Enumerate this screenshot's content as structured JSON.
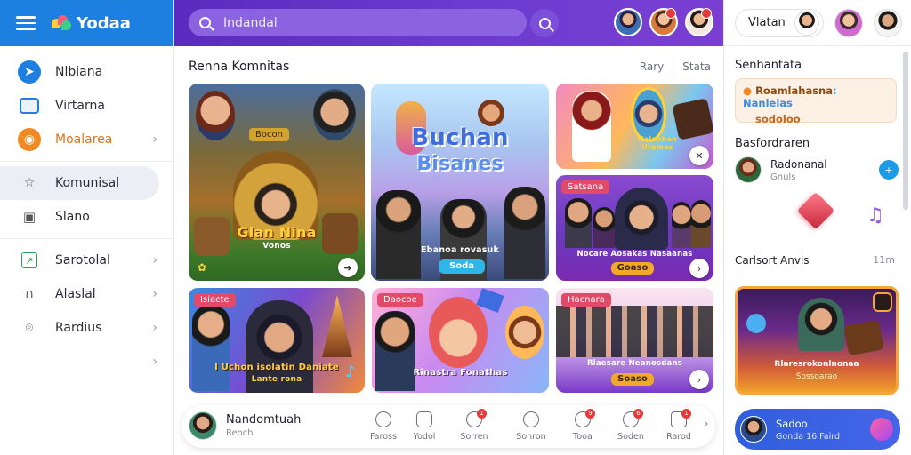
{
  "app": {
    "name": "Yodaa"
  },
  "sidebar": {
    "items": [
      {
        "label": "Nlbiana",
        "icon": "send-icon"
      },
      {
        "label": "Virtarna",
        "icon": "screen-icon"
      },
      {
        "label": "Moalarea",
        "icon": "badge-icon"
      },
      {
        "label": "Komunisal",
        "icon": "star-icon"
      },
      {
        "label": "Slano",
        "icon": "picture-icon"
      },
      {
        "label": "Sarotolal",
        "icon": "chart-icon"
      },
      {
        "label": "Alaslal",
        "icon": "headset-icon"
      },
      {
        "label": "Rardius",
        "icon": "location-icon"
      }
    ]
  },
  "topbar": {
    "search_placeholder": "Indandal"
  },
  "main": {
    "title": "Renna Komnitas",
    "action_1": "Rary",
    "action_2": "Stata",
    "cards": {
      "c1": {
        "chip": "Bocon",
        "caption": "Glan Nina",
        "sub": "Vonos"
      },
      "c2": {
        "heading1": "Buchan",
        "heading2": "Bisanes",
        "caption": "Ebanoa rovasuk",
        "pill": "Soda"
      },
      "c3": {
        "caption": "Haloohan Uramas"
      },
      "c4": {
        "chip": "Satsana",
        "caption": "Nocare Aosakas Nasaanas",
        "pill": "Goaso"
      },
      "c5": {
        "chip": "Isiacte",
        "caption": "I Uchon isolatin Daniate",
        "sub": "Lante rona"
      },
      "c6": {
        "chip": "Daocoe",
        "caption": "Rinastra Fonathas"
      },
      "c7": {
        "chip": "Hacnara",
        "caption": "Rlaesare Neanosdans",
        "pill": "Soaso"
      }
    },
    "dock": {
      "user_name": "Nandomtuah",
      "user_sub": "Reoch",
      "items": [
        {
          "label": "Faross",
          "badge": ""
        },
        {
          "label": "Yodol",
          "badge": ""
        },
        {
          "label": "Sorren",
          "badge": "1"
        },
        {
          "label": "Sonron",
          "badge": ""
        },
        {
          "label": "Tooa",
          "badge": "9"
        },
        {
          "label": "Soden",
          "badge": "6"
        },
        {
          "label": "Rarod",
          "badge": "1"
        }
      ]
    }
  },
  "right": {
    "user_name": "Vlatan",
    "section1_title": "Senhantata",
    "promo_line1a": "Roamlahasna",
    "promo_sep": ":",
    "promo_line1b": "Nanlelas",
    "promo_line2": "sodoloo",
    "section2_title": "Basfordraren",
    "friend_name": "Radonanal",
    "friend_sub": "Gnuls",
    "artist_label": "Carlsort Anvis",
    "artist_meta": "11m",
    "feature_caption": "Rlaresrokonlnonaa",
    "feature_sub": "Sossoarao",
    "player_title": "Sadoo",
    "player_sub": "Gonda 16 Faird"
  },
  "colors": {
    "brand_blue": "#1d7fe0",
    "topbar_purple": "#6c3bd0",
    "accent_orange": "#f08a24",
    "badge_red": "#e63a3a"
  }
}
